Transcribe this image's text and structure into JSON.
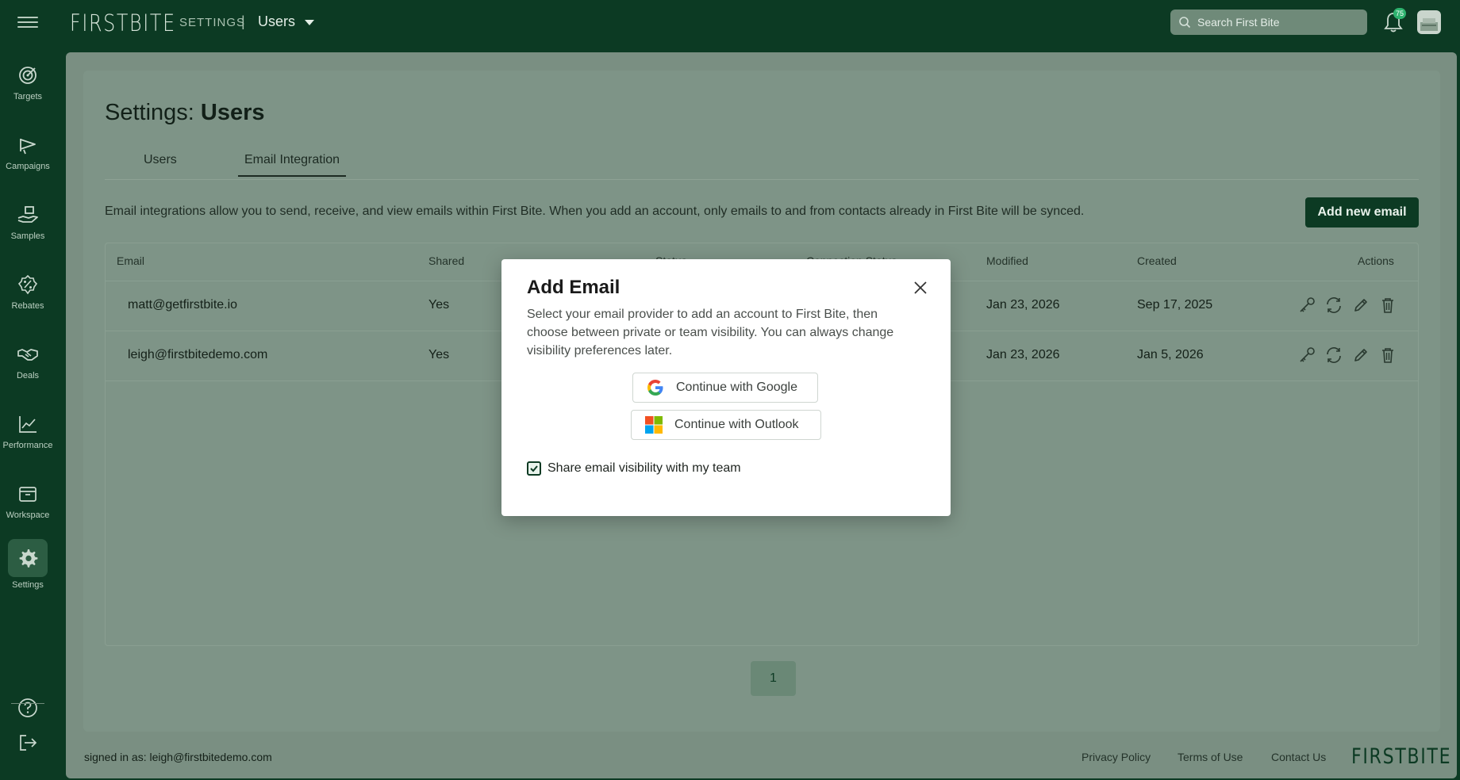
{
  "topbar": {
    "logo": "FIRSTBITE",
    "section": "SETTINGS",
    "separator": "|",
    "current": "Users",
    "search_placeholder": "Search First Bite",
    "notification_count": "75"
  },
  "sidebar": {
    "items": [
      {
        "label": "Targets",
        "icon": "target-icon"
      },
      {
        "label": "Campaigns",
        "icon": "megaphone-icon"
      },
      {
        "label": "Samples",
        "icon": "hand-box-icon"
      },
      {
        "label": "Rebates",
        "icon": "percent-badge-icon"
      },
      {
        "label": "Deals",
        "icon": "handshake-icon"
      },
      {
        "label": "Performance",
        "icon": "chart-line-icon"
      },
      {
        "label": "Workspace",
        "icon": "archive-box-icon"
      },
      {
        "label": "Settings",
        "icon": "gear-icon"
      }
    ],
    "help_icon": "help-circle-icon",
    "logout_icon": "logout-icon"
  },
  "page": {
    "title_prefix": "Settings: ",
    "title_bold": "Users",
    "tabs": [
      {
        "label": "Users",
        "active": false
      },
      {
        "label": "Email Integration",
        "active": true
      }
    ],
    "intro": "Email integrations allow you to send, receive, and view emails within First Bite. When you add an account, only emails to and from contacts already in First Bite will be synced.",
    "add_button": "Add new email"
  },
  "table": {
    "headers": [
      "Email",
      "Shared",
      "Status",
      "Connection Status",
      "Modified",
      "Created",
      "Actions"
    ],
    "rows": [
      {
        "email": "matt@getfirstbite.io",
        "shared": "Yes",
        "modified": "Jan 23, 2026",
        "created": "Sep 17, 2025"
      },
      {
        "email": "leigh@firstbitedemo.com",
        "shared": "Yes",
        "modified": "Jan 23, 2026",
        "created": "Jan 5, 2026"
      }
    ],
    "action_icons": [
      "key-icon",
      "sync-icon",
      "pencil-icon",
      "trash-icon"
    ]
  },
  "pagination": {
    "current_page": "1"
  },
  "footer": {
    "signed_in_label": "signed in as: ",
    "signed_in_email": "leigh@firstbitedemo.com",
    "links": [
      "Privacy Policy",
      "Terms of Use",
      "Contact Us"
    ],
    "logo": "FIRSTBITE"
  },
  "modal": {
    "title": "Add Email",
    "description": "Select your email provider to add an account to First Bite, then choose between private or team visibility. You can always change visibility preferences later.",
    "google_button": "Continue with Google",
    "outlook_button": "Continue with Outlook",
    "share_checkbox_label": "Share email visibility with my team",
    "share_checked": true
  },
  "colors": {
    "brand_dark": "#0c3a23",
    "overlay": "#7e9487",
    "badge": "#2eb36f"
  }
}
